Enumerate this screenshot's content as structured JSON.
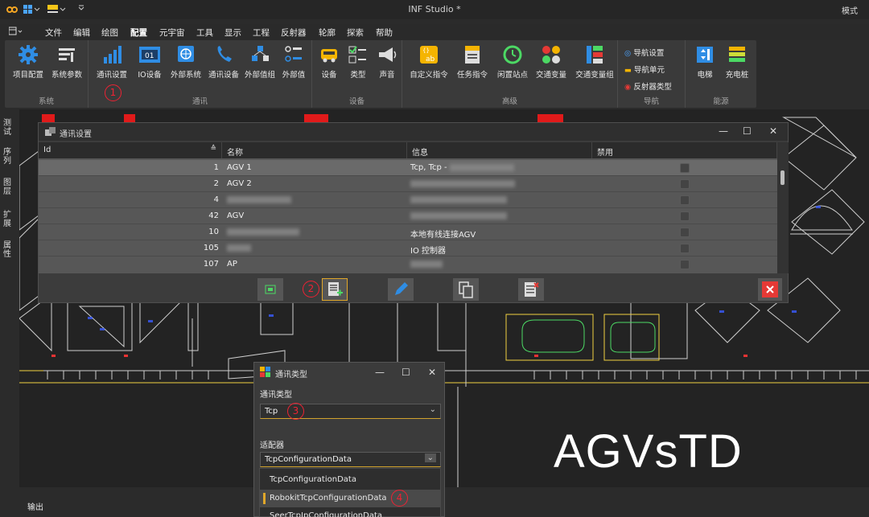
{
  "window": {
    "title": "INF Studio *",
    "mode_label": "模式"
  },
  "menu": [
    "文件",
    "编辑",
    "绘图",
    "配置",
    "元宇宙",
    "工具",
    "显示",
    "工程",
    "反射器",
    "轮廓",
    "探索",
    "帮助"
  ],
  "ribbon": {
    "system": {
      "label": "系统",
      "buttons": [
        "项目配置",
        "系统参数"
      ]
    },
    "comm": {
      "label": "通讯",
      "buttons": [
        "通讯设置",
        "IO设备",
        "外部系统",
        "通讯设备",
        "外部值组",
        "外部值"
      ]
    },
    "device": {
      "label": "设备",
      "buttons": [
        "设备",
        "类型",
        "声音"
      ]
    },
    "advanced": {
      "label": "高级",
      "buttons": [
        "自定义指令",
        "任务指令",
        "闲置站点",
        "交通变量",
        "交通变量组"
      ]
    },
    "nav": {
      "label": "导航",
      "items": [
        "导航设置",
        "导航单元",
        "反射器类型"
      ]
    },
    "energy": {
      "label": "能源",
      "buttons": [
        "电梯",
        "充电桩"
      ]
    }
  },
  "left_tabs": [
    "测试",
    "序列",
    "图层",
    "扩展",
    "属性"
  ],
  "comm_dialog": {
    "title": "通讯设置",
    "columns": [
      "Id",
      "名称",
      "信息",
      "禁用"
    ],
    "rows": [
      {
        "id": "1",
        "name": "AGV 1",
        "info": "Tcp, Tcp -"
      },
      {
        "id": "2",
        "name": "AGV 2",
        "info": ""
      },
      {
        "id": "4",
        "name": "",
        "info": ""
      },
      {
        "id": "42",
        "name": "AGV",
        "info": ""
      },
      {
        "id": "10",
        "name": "",
        "info": "本地有线连接AGV"
      },
      {
        "id": "105",
        "name": "",
        "info": "IO 控制器"
      },
      {
        "id": "107",
        "name": "AP",
        "info": ""
      }
    ]
  },
  "annotations": {
    "n1": "1",
    "n2": "2",
    "n3": "3",
    "n4": "4"
  },
  "type_dialog": {
    "title": "通讯类型",
    "type_label": "通讯类型",
    "type_value": "Tcp",
    "adapter_label": "适配器",
    "adapter_value": "TcpConfigurationData",
    "options": [
      "TcpConfigurationData",
      "RobokitTcpConfigurationData",
      "SeerTcpIpConfigurationData"
    ]
  },
  "watermark": "AGVsTD",
  "output_label": "输出"
}
